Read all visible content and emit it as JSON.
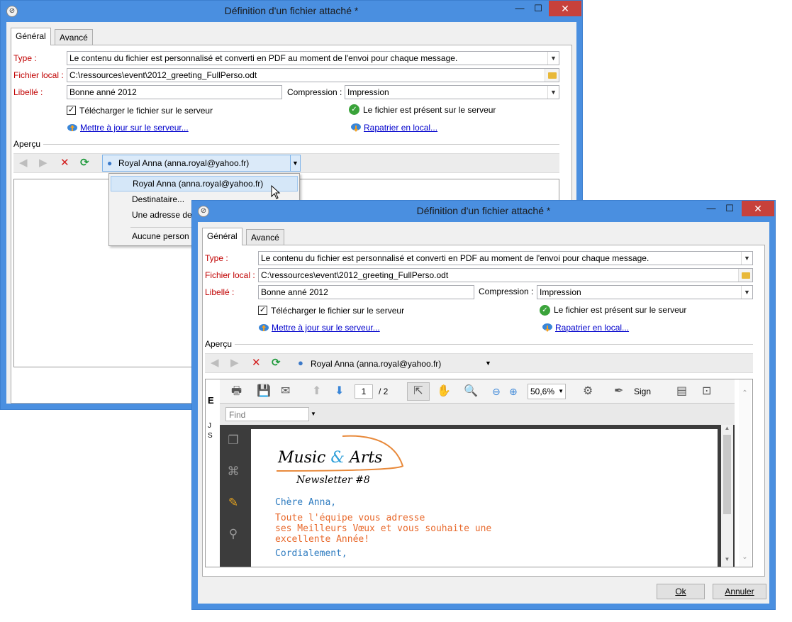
{
  "dialog_title": "Définition d'un fichier attaché *",
  "window_controls": {
    "minimize": "—",
    "maximize": "☐",
    "close": "✕"
  },
  "tabs": [
    {
      "label": "Général"
    },
    {
      "label": "Avancé"
    }
  ],
  "form": {
    "type_label": "Type :",
    "type_value": "Le contenu du fichier est personnalisé et converti en PDF au moment de l'envoi pour chaque message.",
    "file_label": "Fichier local :",
    "file_value": "C:\\ressources\\event\\2012_greeting_FullPerso.odt",
    "libelle_label": "Libellé :",
    "libelle_value": "Bonne anné 2012",
    "compression_label": "Compression :",
    "compression_value": "Impression",
    "upload_checkbox_label": "Télécharger le fichier sur le serveur",
    "upload_checked": true,
    "server_status": "Le fichier est présent sur le serveur",
    "update_link": "Mettre à jour sur le serveur...",
    "repatriate_link": "Rapatrier en local..."
  },
  "apercu": {
    "label": "Aperçu",
    "recipient": "Royal Anna (anna.royal@yahoo.fr)"
  },
  "dropdown_menu": {
    "items": [
      "Royal Anna (anna.royal@yahoo.fr)",
      "Destinataire...",
      "Une adresse de",
      "Aucune person"
    ]
  },
  "pdf_viewer": {
    "page_current": "1",
    "page_total": "/ 2",
    "zoom": "50,6%",
    "sign_label": "Sign",
    "find_placeholder": "Find",
    "left_fragments": [
      "E",
      "J",
      "S"
    ]
  },
  "newsletter": {
    "brand_part1": "Music",
    "brand_amp": "&",
    "brand_part2": "Arts",
    "subtitle": "Newsletter #8",
    "greeting": "Chère Anna,",
    "body_line1": "Toute l'équipe vous adresse",
    "body_line2": "ses Meilleurs Vœux et vous souhaite une",
    "body_line3": "excellente Année!",
    "closing": "Cordialement,"
  },
  "buttons": {
    "ok": "Ok",
    "cancel": "Annuler"
  },
  "colors": {
    "accent": "#4a8fe0",
    "required_label": "#c00000",
    "link": "#0000cc",
    "newsletter_blue": "#2f7cc0",
    "newsletter_orange": "#e8692c"
  }
}
